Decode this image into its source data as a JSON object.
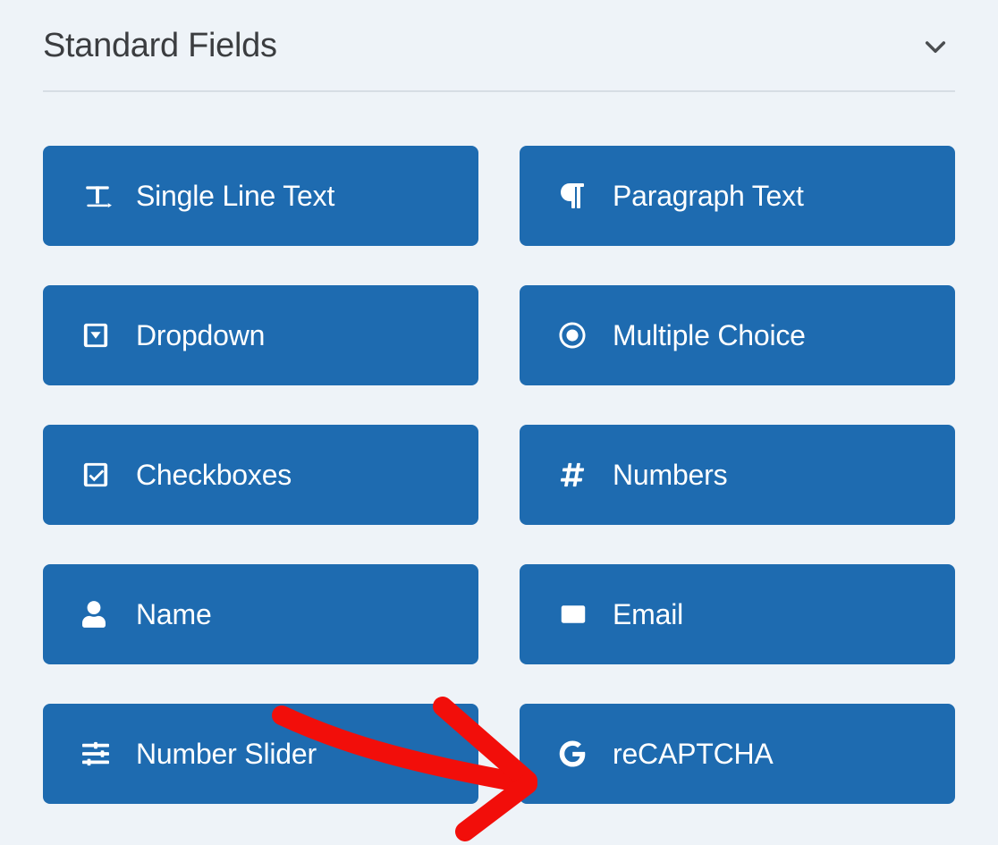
{
  "section": {
    "title": "Standard Fields"
  },
  "fields": [
    {
      "name": "single-line-text",
      "label": "Single Line Text",
      "icon": "text-cursor-icon"
    },
    {
      "name": "paragraph-text",
      "label": "Paragraph Text",
      "icon": "paragraph-icon"
    },
    {
      "name": "dropdown",
      "label": "Dropdown",
      "icon": "dropdown-icon"
    },
    {
      "name": "multiple-choice",
      "label": "Multiple Choice",
      "icon": "radio-dot-icon"
    },
    {
      "name": "checkboxes",
      "label": "Checkboxes",
      "icon": "checkbox-check-icon"
    },
    {
      "name": "numbers",
      "label": "Numbers",
      "icon": "hash-icon"
    },
    {
      "name": "name",
      "label": "Name",
      "icon": "user-icon"
    },
    {
      "name": "email",
      "label": "Email",
      "icon": "envelope-icon"
    },
    {
      "name": "number-slider",
      "label": "Number Slider",
      "icon": "sliders-icon"
    },
    {
      "name": "recaptcha",
      "label": "reCAPTCHA",
      "icon": "google-g-icon"
    }
  ],
  "colors": {
    "button_bg": "#1e6bb0",
    "page_bg": "#eef3f8",
    "title_color": "#3b3d40",
    "annotation": "#f20e0a"
  }
}
